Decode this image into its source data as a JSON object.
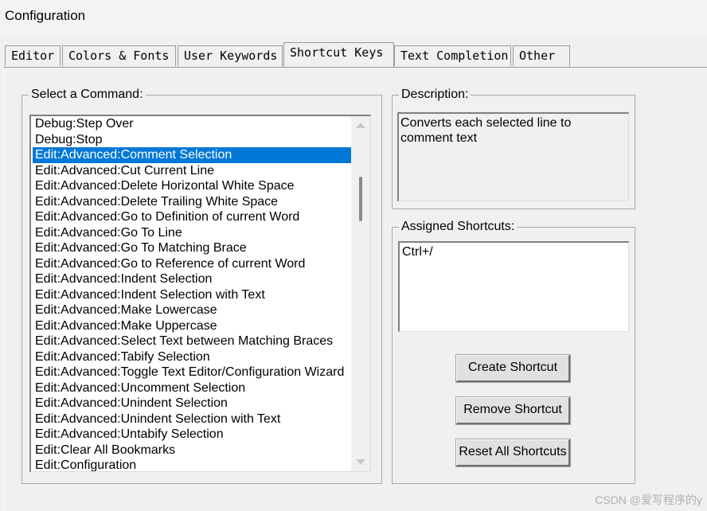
{
  "window": {
    "title": "Configuration"
  },
  "tabs": [
    {
      "label": "Editor",
      "active": false
    },
    {
      "label": "Colors & Fonts",
      "active": false
    },
    {
      "label": "User Keywords",
      "active": false
    },
    {
      "label": "Shortcut Keys",
      "active": true
    },
    {
      "label": "Text Completion",
      "active": false
    },
    {
      "label": "Other",
      "active": false
    }
  ],
  "commands": {
    "label": "Select a Command:",
    "selected_index": 2,
    "items": [
      "Debug:Step Over",
      "Debug:Stop",
      "Edit:Advanced:Comment Selection",
      "Edit:Advanced:Cut Current Line",
      "Edit:Advanced:Delete Horizontal White Space",
      "Edit:Advanced:Delete Trailing White Space",
      "Edit:Advanced:Go to Definition of current Word",
      "Edit:Advanced:Go To Line",
      "Edit:Advanced:Go To Matching Brace",
      "Edit:Advanced:Go to Reference of current Word",
      "Edit:Advanced:Indent Selection",
      "Edit:Advanced:Indent Selection with Text",
      "Edit:Advanced:Make Lowercase",
      "Edit:Advanced:Make Uppercase",
      "Edit:Advanced:Select Text between Matching Braces",
      "Edit:Advanced:Tabify Selection",
      "Edit:Advanced:Toggle Text Editor/Configuration Wizard",
      "Edit:Advanced:Uncomment Selection",
      "Edit:Advanced:Unindent Selection",
      "Edit:Advanced:Unindent Selection with Text",
      "Edit:Advanced:Untabify Selection",
      "Edit:Clear All Bookmarks",
      "Edit:Configuration"
    ]
  },
  "description": {
    "label": "Description:",
    "text": "Converts each selected line to comment text"
  },
  "shortcuts": {
    "label": "Assigned Shortcuts:",
    "items": [
      "Ctrl+/"
    ]
  },
  "buttons": {
    "create": "Create Shortcut",
    "remove": "Remove Shortcut",
    "reset": "Reset All Shortcuts"
  },
  "watermark": "CSDN @爱写程序的y",
  "colors": {
    "selection": "#0078d7",
    "background": "#f0f0f0"
  }
}
